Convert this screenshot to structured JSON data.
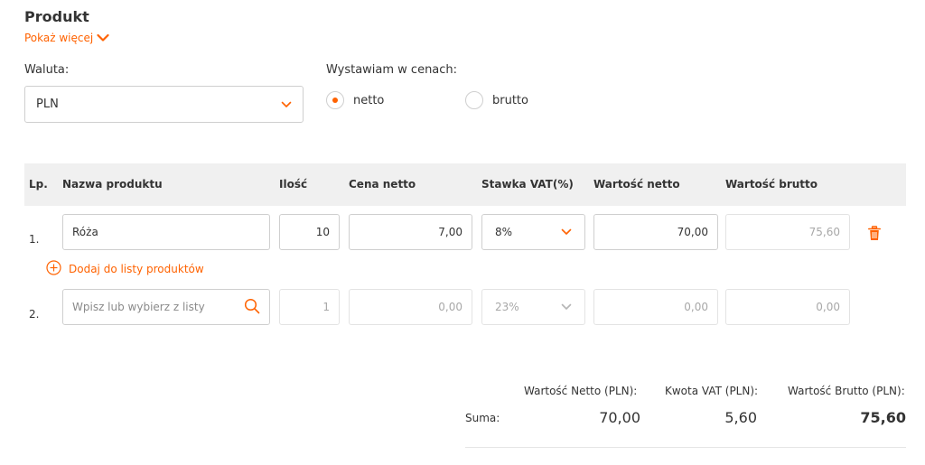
{
  "section": {
    "title": "Produkt",
    "show_more": "Pokaż więcej"
  },
  "currency": {
    "label": "Waluta:",
    "value": "PLN"
  },
  "pricing": {
    "label": "Wystawiam w cenach:",
    "options": [
      "netto",
      "brutto"
    ],
    "selected": "netto"
  },
  "table": {
    "headers": [
      "Lp.",
      "Nazwa produktu",
      "Ilość",
      "Cena netto",
      "Stawka VAT(%)",
      "Wartość netto",
      "Wartość brutto"
    ],
    "rows": [
      {
        "lp": "1.",
        "name": "Róża",
        "qty": "10",
        "price_net": "7,00",
        "vat": "8%",
        "value_net": "70,00",
        "value_gross": "75,60"
      },
      {
        "lp": "2.",
        "name_placeholder": "Wpisz lub wybierz z listy",
        "qty": "1",
        "price_net": "0,00",
        "vat": "23%",
        "value_net": "0,00",
        "value_gross": "0,00"
      }
    ],
    "add_link": "Dodaj do listy produktów"
  },
  "summary": {
    "label": "Suma:",
    "headers": [
      "Wartość Netto (PLN):",
      "Kwota VAT (PLN):",
      "Wartość Brutto (PLN):"
    ],
    "values": [
      "70,00",
      "5,60",
      "75,60"
    ]
  },
  "colors": {
    "accent": "#ff6200",
    "header_bg": "#f0f0f0",
    "border": "#cfcfcf"
  }
}
